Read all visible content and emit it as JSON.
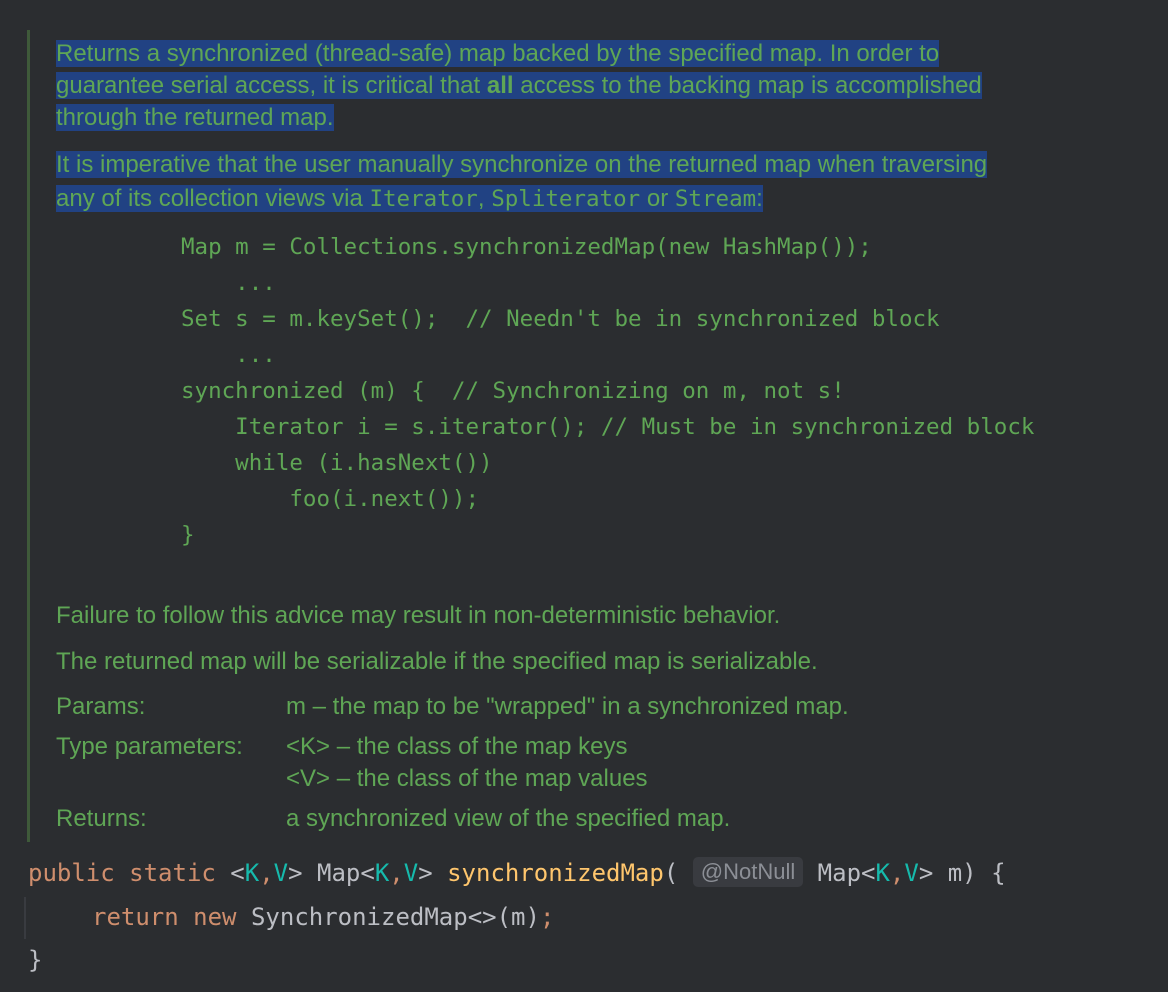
{
  "doc": {
    "p1_lines": [
      "Returns a synchronized (thread-safe) map backed by the specified map. In order to",
      "guarantee serial access, it is critical that ",
      "all",
      " access to the backing map is accomplished",
      "through the returned map."
    ],
    "p2_line1": "It is imperative that the user manually synchronize on the returned map when traversing",
    "p2_line2_prefix": "any of its collection views via ",
    "p2_iterator": "Iterator",
    "p2_comma": ", ",
    "p2_spliterator": "Spliterator",
    "p2_or": " or ",
    "p2_stream": "Stream",
    "p2_colon": ":",
    "code_lines": [
      "Map m = Collections.synchronizedMap(new HashMap());",
      "    ...",
      "Set s = m.keySet();  // Needn't be in synchronized block",
      "    ...",
      "synchronized (m) {  // Synchronizing on m, not s!",
      "    Iterator i = s.iterator(); // Must be in synchronized block",
      "    while (i.hasNext())",
      "        foo(i.next());",
      "}"
    ],
    "p3": "Failure to follow this advice may result in non-deterministic behavior.",
    "p4": "The returned map will be serializable if the specified map is serializable.",
    "params_label": "Params:",
    "params_value": "m – the map to be \"wrapped\" in a synchronized map.",
    "type_params_label": "Type parameters:",
    "type_param_k": "<K> – the class of the map keys",
    "type_param_v": "<V> – the class of the map values",
    "returns_label": "Returns:",
    "returns_value": "a synchronized view of the specified map."
  },
  "source": {
    "kw_public": "public",
    "kw_static": "static",
    "generic_open": " <",
    "tp_k": "K",
    "comma": ",",
    "tp_v": "V",
    "generic_close": ">",
    "map_type": " Map<",
    "method_name": "synchronizedMap",
    "paren_open": "(",
    "annotation_hint": "@NotNull",
    "param_type": "Map<",
    "param_rest": "> m) {",
    "kw_return": "return",
    "kw_new": "new",
    "return_expr": " SynchronizedMap<>(m)",
    "semicolon": ";",
    "close_brace": "}"
  },
  "colors": {
    "background": "#2b2d30",
    "doc_text": "#5fa655",
    "selection": "#214283",
    "keyword": "#cf8e6d",
    "method": "#ffc66d",
    "type_param": "#16baac",
    "default_text": "#bcbec4"
  }
}
